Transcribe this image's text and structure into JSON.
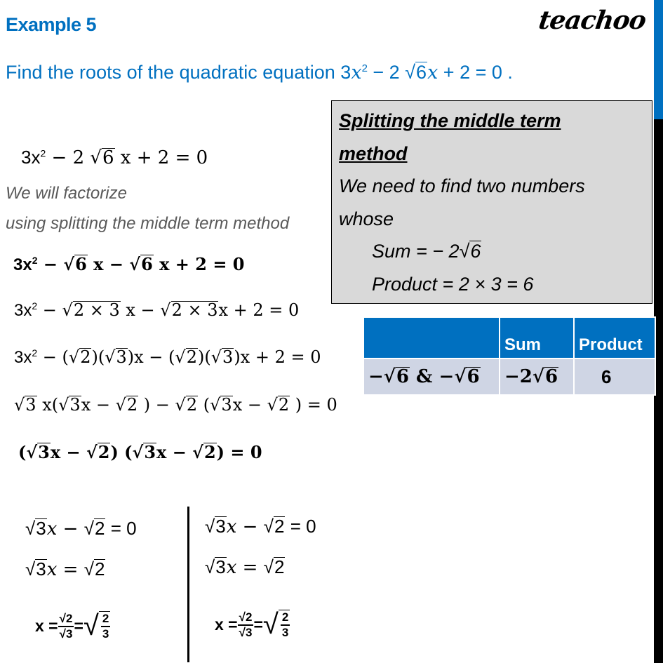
{
  "header": {
    "title": "Example 5",
    "logo": "teachoo"
  },
  "question": {
    "prefix": "Find the roots of the quadratic equation 3",
    "var": "x",
    "exp": "2",
    "middle": " − 2 ",
    "radicand": "6",
    "tail": " + 2 = 0 ."
  },
  "method_box": {
    "heading_line1": "Splitting the middle term",
    "heading_line2": "method",
    "text_line1": "We need to find two numbers",
    "text_line2": "whose",
    "sum_label": "Sum =  − 2",
    "sum_radicand": "6",
    "product_line": "Product = 2 × 3 = 6"
  },
  "table": {
    "headers": [
      "",
      "Sum",
      "Product"
    ],
    "row": {
      "numbers_prefix": "−",
      "numbers_radicand": "6",
      "numbers_mid": " & −",
      "sum_prefix": "−2",
      "sum_radicand": "6",
      "product": "6"
    }
  },
  "steps": {
    "given": {
      "lead": "3x",
      "exp": "2",
      "a": " − 2 ",
      "rad": "6",
      "b": " x + 2 = 0"
    },
    "note_line1": "We will factorize",
    "note_line2": "using splitting the middle term method",
    "split": {
      "lead": "3x",
      "exp": "2",
      "a": " − ",
      "rad": "6",
      "b": " x − ",
      "rad2": "6",
      "c": " x + 2 = 0"
    },
    "expand": {
      "lead": "3x",
      "exp": "2",
      "a": " − ",
      "rad": "2 × 3",
      "b": " x − ",
      "rad2": "2 × 3",
      "c": "x + 2 = 0"
    },
    "product_form": {
      "lead": "3x",
      "exp": "2",
      "a": " − (",
      "r1": "2",
      "b": ")(",
      "r2": "3",
      "c": ")x − (",
      "r3": "2",
      "d": ")(",
      "r4": "3",
      "e": ")x + 2 = 0"
    },
    "grouping": {
      "r1": "3",
      "a": " x(",
      "r2": "3",
      "b": "x − ",
      "r3": "2",
      "c": " ) − ",
      "r4": "2",
      "d": "  (",
      "r5": "3",
      "e": "x − ",
      "r6": "2",
      "f": " ) = 0"
    },
    "factored": {
      "a": "(",
      "r1": "3",
      "b": "x  − ",
      "r2": "2",
      "c": ") (",
      "r3": "3",
      "d": "x − ",
      "r4": "2",
      "e": ") = 0"
    }
  },
  "solutions": [
    {
      "line1": {
        "r1": "3",
        "a": "x  − ",
        "r2": "2",
        "b": " = 0"
      },
      "line2": {
        "r1": "3",
        "a": "x = ",
        "r2": "2"
      },
      "line3": {
        "lead": "x = ",
        "num_rad": "2",
        "den_rad": "3",
        "eq": " = ",
        "frac_num": "2",
        "frac_den": "3"
      }
    },
    {
      "line1": {
        "r1": "3",
        "a": "x  − ",
        "r2": "2",
        "b": " = 0"
      },
      "line2": {
        "r1": "3",
        "a": "x = ",
        "r2": "2"
      },
      "line3": {
        "lead": "x = ",
        "num_rad": "2",
        "den_rad": "3",
        "eq": " = ",
        "frac_num": "2",
        "frac_den": "3"
      }
    }
  ],
  "colors": {
    "accent_blue": "#0070c0",
    "box_gray": "#d9d9d9",
    "table_row": "#cfd5e4",
    "note_gray": "#595959"
  }
}
